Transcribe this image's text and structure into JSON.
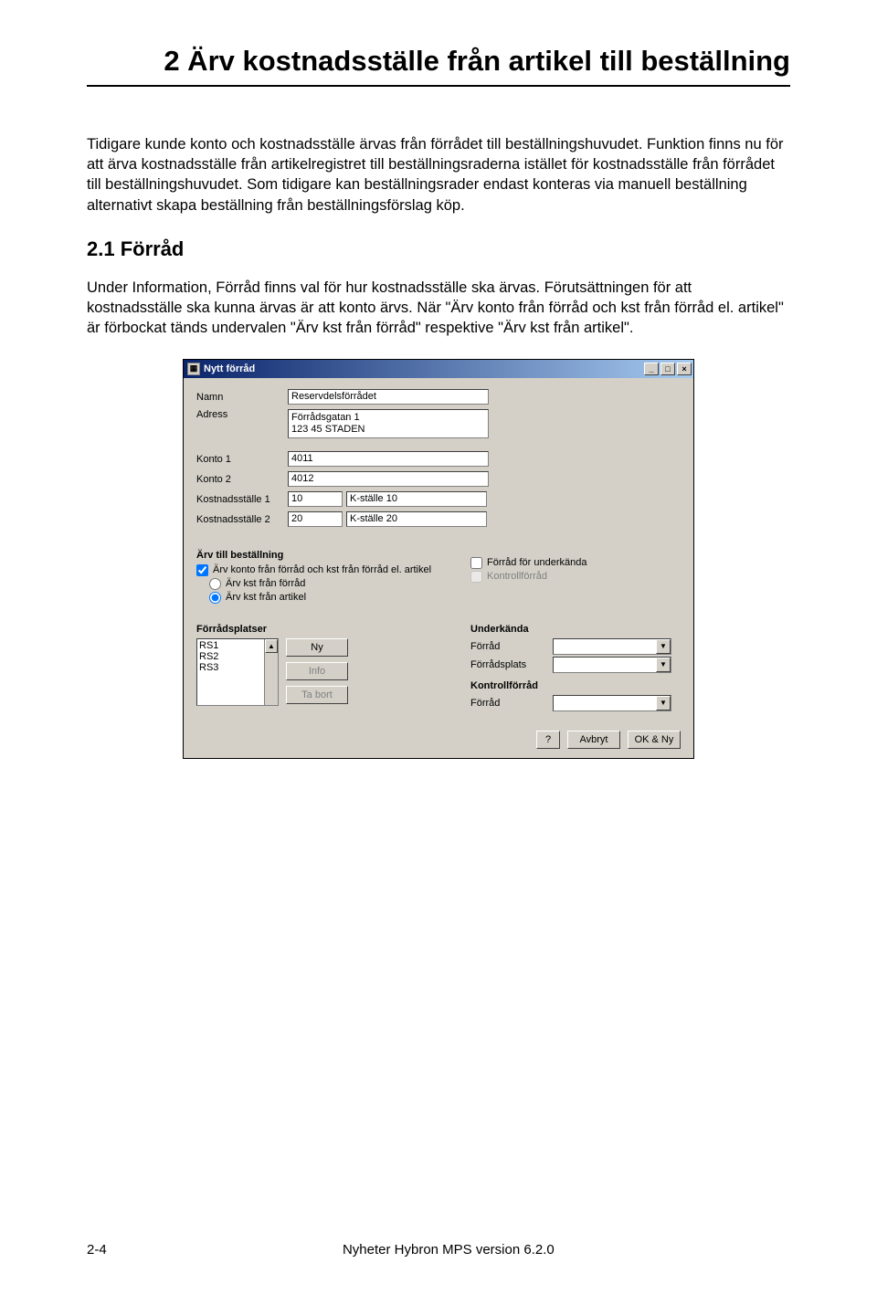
{
  "document": {
    "title": "2 Ärv kostnadsställe från artikel till beställning",
    "para1": "Tidigare kunde konto och kostnadsställe ärvas från förrådet till beställningshuvudet. Funktion finns nu för att ärva kostnadsställe från artikelregistret till beställningsraderna istället för kostnadsställe från förrådet till beställningshuvudet. Som tidigare kan beställningsrader endast konteras via manuell beställning alternativt skapa beställning från beställningsförslag köp.",
    "section": "2.1 Förråd",
    "para2": "Under Information, Förråd finns val för hur kostnadsställe ska ärvas. Förutsättningen för att kostnadsställe ska kunna ärvas är att konto ärvs. När \"Ärv konto från förråd och kst från förråd el. artikel\" är förbockat tänds undervalen \"Ärv kst från förråd\" respektive \"Ärv kst från artikel\"."
  },
  "dialog": {
    "title": "Nytt förråd",
    "labels": {
      "namn": "Namn",
      "adress": "Adress",
      "konto1": "Konto 1",
      "konto2": "Konto 2",
      "kst1": "Kostnadsställe 1",
      "kst2": "Kostnadsställe 2"
    },
    "values": {
      "namn": "Reservdelsförrådet",
      "adress": "Förrådsgatan 1\n123 45 STADEN",
      "konto1": "4011",
      "konto2": "4012",
      "kst1_code": "10",
      "kst1_desc": "K-ställe 10",
      "kst2_code": "20",
      "kst2_desc": "K-ställe 20"
    },
    "group_arv": "Ärv till beställning",
    "chk_arv_konto": "Ärv konto från förråd och kst från förråd el. artikel",
    "rad_forrad": "Ärv kst från förråd",
    "rad_artikel": "Ärv kst från artikel",
    "chk_underkanda": "Förråd för underkända",
    "chk_kontroll": "Kontrollförråd",
    "group_platser": "Förrådsplatser",
    "list_items": [
      "RS1",
      "RS2",
      "RS3"
    ],
    "btn_ny": "Ny",
    "btn_info": "Info",
    "btn_tabort": "Ta bort",
    "group_underkanda": "Underkända",
    "lbl_forrad": "Förråd",
    "lbl_forradsplats": "Förrådsplats",
    "group_kontrollforrad": "Kontrollförråd",
    "btn_help": "?",
    "btn_avbryt": "Avbryt",
    "btn_okny": "OK & Ny"
  },
  "footer": {
    "page": "2-4",
    "text": "Nyheter Hybron MPS version 6.2.0"
  }
}
